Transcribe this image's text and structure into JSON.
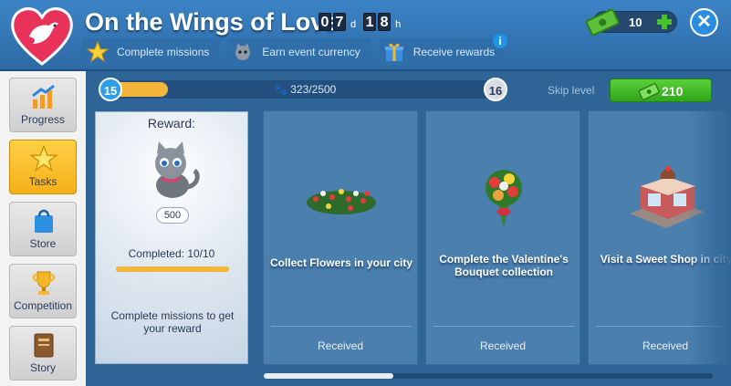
{
  "header": {
    "title": "On the Wings of Love",
    "timer": {
      "days": [
        "0",
        "7"
      ],
      "day_unit": "d",
      "hours": [
        "1",
        "8"
      ],
      "hour_unit": "h"
    },
    "tabs": [
      {
        "label": "Complete missions",
        "icon": "star-icon"
      },
      {
        "label": "Earn event currency",
        "icon": "kitten-token-icon"
      },
      {
        "label": "Receive rewards",
        "icon": "gift-icon"
      }
    ],
    "cash": "10"
  },
  "sidebar": {
    "items": [
      {
        "label": "Progress",
        "icon": "chart-arrow-icon",
        "active": false
      },
      {
        "label": "Tasks",
        "icon": "star-icon",
        "active": true
      },
      {
        "label": "Store",
        "icon": "shopping-bag-icon",
        "active": false
      },
      {
        "label": "Competition",
        "icon": "trophy-icon",
        "active": false
      },
      {
        "label": "Story",
        "icon": "book-icon",
        "active": false
      }
    ]
  },
  "level": {
    "current": "15",
    "next": "16",
    "progress_text": "323/2500",
    "progress_fraction": 0.129
  },
  "skip": {
    "label": "Skip level",
    "cost": "210"
  },
  "reward": {
    "title": "Reward:",
    "amount": "500",
    "completed": "Completed: 10/10",
    "completed_fraction": 1.0,
    "description": "Complete missions to get your reward"
  },
  "missions": [
    {
      "title": "Collect Flowers in your city",
      "status": "Received",
      "icon": "flowerbed-icon"
    },
    {
      "title": "Complete the Valentine's Bouquet collection",
      "status": "Received",
      "icon": "bouquet-icon"
    },
    {
      "title": "Visit a Sweet Shop in city",
      "status": "Received",
      "icon": "sweet-shop-icon"
    }
  ],
  "colors": {
    "accent_green": "#3cbf25",
    "active_tab": "#f8bf2e",
    "header_blue": "#3c84c6"
  }
}
